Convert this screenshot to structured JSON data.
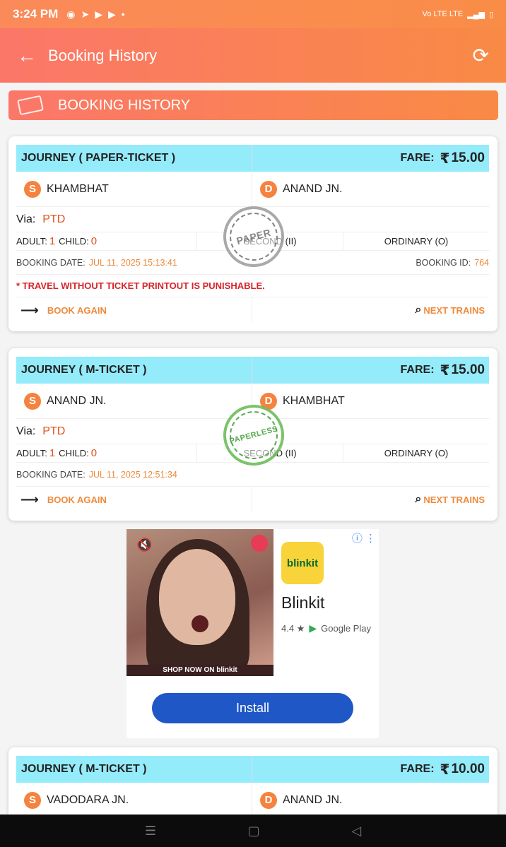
{
  "status_bar": {
    "time": "3:24 PM",
    "right": "Vo LTE  LTE"
  },
  "app_bar": {
    "title": "Booking History"
  },
  "banner": {
    "label": "BOOKING HISTORY"
  },
  "cards": [
    {
      "journey": "JOURNEY ( PAPER-TICKET )",
      "fare_label": "FARE:",
      "currency": "₹",
      "fare": "15.00",
      "source_badge": "S",
      "source": "KHAMBHAT",
      "dest_badge": "D",
      "destination": "ANAND JN.",
      "via_label": "Via:",
      "via": "PTD",
      "adult_label": "ADULT:",
      "adult": "1",
      "child_label": "CHILD:",
      "child": "0",
      "class": "SECOND (II)",
      "type": "ORDINARY (O)",
      "booking_date_label": "BOOKING DATE:",
      "booking_date": "JUL 11, 2025 15:13:41",
      "booking_id_label": "BOOKING ID:",
      "booking_id": "764",
      "warning": "* TRAVEL WITHOUT TICKET PRINTOUT IS PUNISHABLE.",
      "book_again": "BOOK AGAIN",
      "next_trains": "NEXT TRAINS",
      "stamp": "PAPER"
    },
    {
      "journey": "JOURNEY ( M-TICKET )",
      "fare_label": "FARE:",
      "currency": "₹",
      "fare": "15.00",
      "source_badge": "S",
      "source": "ANAND JN.",
      "dest_badge": "D",
      "destination": "KHAMBHAT",
      "via_label": "Via:",
      "via": "PTD",
      "adult_label": "ADULT:",
      "adult": "1",
      "child_label": "CHILD:",
      "child": "0",
      "class": "SECOND (II)",
      "type": "ORDINARY (O)",
      "booking_date_label": "BOOKING DATE:",
      "booking_date": "JUL 11, 2025 12:51:34",
      "book_again": "BOOK AGAIN",
      "next_trains": "NEXT TRAINS",
      "stamp": "PAPERLESS"
    },
    {
      "journey": "JOURNEY ( M-TICKET )",
      "fare_label": "FARE:",
      "currency": "₹",
      "fare": "10.00",
      "source_badge": "S",
      "source": "VADODARA JN.",
      "dest_badge": "D",
      "destination": "ANAND JN."
    }
  ],
  "ad": {
    "brand_logo": "blinkit",
    "name": "Blinkit",
    "rating": "4.4 ★",
    "store": "Google Play",
    "video_caption": "SHOP NOW ON blinkit",
    "install": "Install"
  },
  "colors": {
    "accent": "#f98a45",
    "header_cyan": "#94ebfa",
    "value_orange": "#ee8a3c",
    "warning_red": "#d8232a"
  }
}
